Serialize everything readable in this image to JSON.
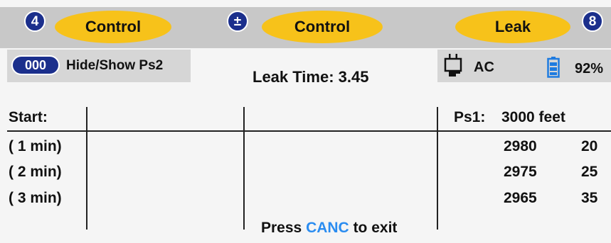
{
  "top_bar": {
    "left_badge": "4",
    "left_button": "Control",
    "middle_badge": "±",
    "middle_button": "Control",
    "right_button": "Leak",
    "right_badge": "8"
  },
  "ps2_toggle": {
    "badge": "000",
    "label": "Hide/Show Ps2"
  },
  "leak_time": "Leak Time: 3.45",
  "power": {
    "source": "AC",
    "source_icon": "plug-icon",
    "battery_icon": "battery-icon",
    "battery_level": "92%",
    "accent_color": "#1e7be0"
  },
  "table": {
    "start_label": "Start:",
    "ps1_label": "Ps1:",
    "ps1_value": "3000 feet",
    "rows": [
      {
        "label": "( 1 min)",
        "value": "2980",
        "delta": "20"
      },
      {
        "label": "( 2 min)",
        "value": "2975",
        "delta": "25"
      },
      {
        "label": "( 3 min)",
        "value": "2965",
        "delta": "35"
      }
    ]
  },
  "footer": {
    "prefix": "Press ",
    "key": "CANC",
    "suffix": " to exit"
  },
  "colors": {
    "button_yellow": "#f7c21a",
    "badge_blue": "#1b2f8c",
    "key_highlight": "#2a8cf0"
  }
}
